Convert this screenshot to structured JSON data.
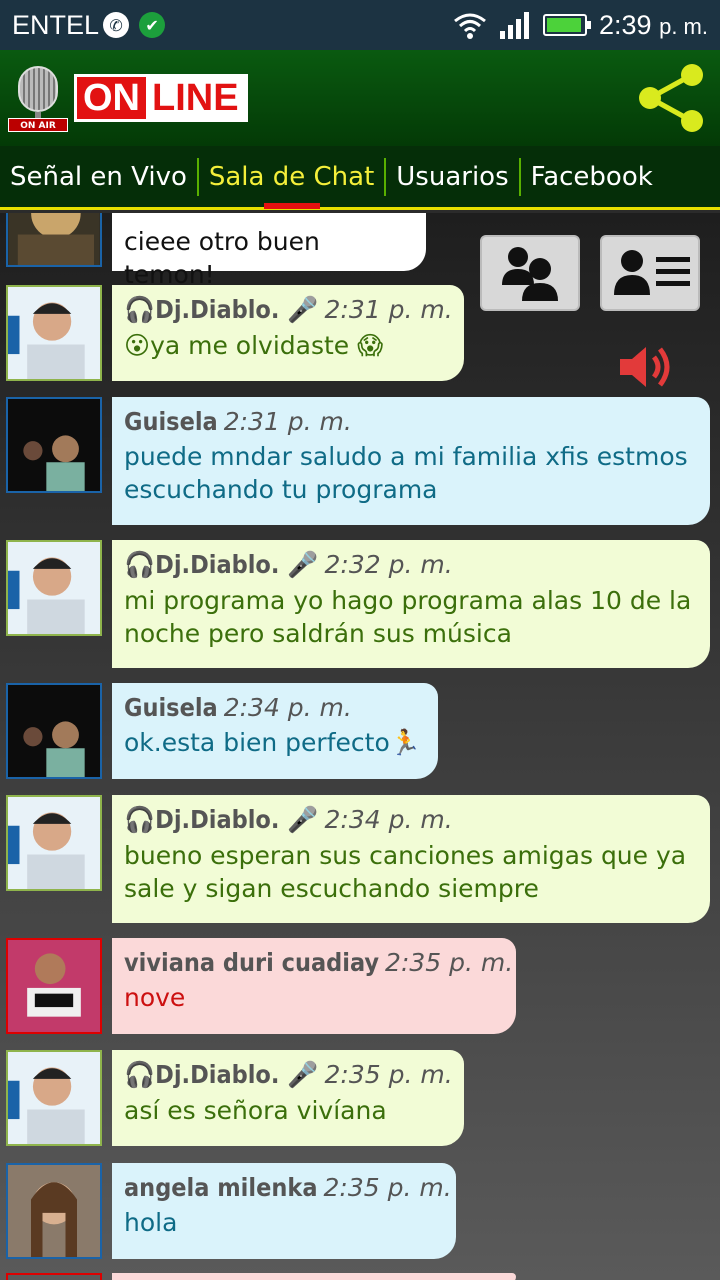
{
  "status_bar": {
    "carrier": "ENTEL",
    "time": "2:39",
    "time_suffix": "p. m.",
    "icons": [
      "whatsapp-icon",
      "check-icon",
      "wifi-icon",
      "signal-icon",
      "battery-icon"
    ]
  },
  "header": {
    "mic_label": "ON AIR",
    "logo_on": "ON",
    "logo_line": "LINE",
    "share_icon": "share-icon"
  },
  "tabs": [
    {
      "label": "Señal en Vivo",
      "active": false
    },
    {
      "label": "Sala de Chat",
      "active": true
    },
    {
      "label": "Usuarios",
      "active": false
    },
    {
      "label": "Facebook",
      "active": false
    }
  ],
  "colors": {
    "header_green": "#0a5a10",
    "tab_active": "#f4ef3a",
    "tab_indicator": "#e51010",
    "bubble_green": "#f2fcd6",
    "bubble_blue": "#daf3fb",
    "bubble_pink": "#fbd9d9"
  },
  "messages": [
    {
      "name": "",
      "time": "",
      "text": "cieee otro buen temon!",
      "style": "white"
    },
    {
      "name": "Dj.Diablo.",
      "time": "2:31 p. m.",
      "text": "ya me olvidaste",
      "style": "green"
    },
    {
      "name": "Guisela",
      "time": "2:31 p. m.",
      "text": "puede mndar saludo a mi familia xfis estmos escuchando tu programa",
      "style": "blue"
    },
    {
      "name": "Dj.Diablo.",
      "time": "2:32 p. m.",
      "text": "mi programa yo hago programa alas 10 de la noche pero saldrán sus música",
      "style": "green"
    },
    {
      "name": "Guisela",
      "time": "2:34 p. m.",
      "text": "ok.esta bien perfecto",
      "style": "blue"
    },
    {
      "name": "Dj.Diablo.",
      "time": "2:34 p. m.",
      "text": "bueno esperan sus canciones amigas que ya sale y sigan escuchando siempre",
      "style": "green"
    },
    {
      "name": "viviana duri cuadiay",
      "time": "2:35 p. m.",
      "text": "nove",
      "style": "pink"
    },
    {
      "name": "Dj.Diablo.",
      "time": "2:35 p. m.",
      "text": "así es señora vivíana",
      "style": "green"
    },
    {
      "name": "angela milenka",
      "time": "2:35 p. m.",
      "text": "hola",
      "style": "blue"
    }
  ],
  "side_buttons": {
    "users": "users-icon",
    "profile": "profile-card-icon",
    "volume": "volume-icon"
  }
}
